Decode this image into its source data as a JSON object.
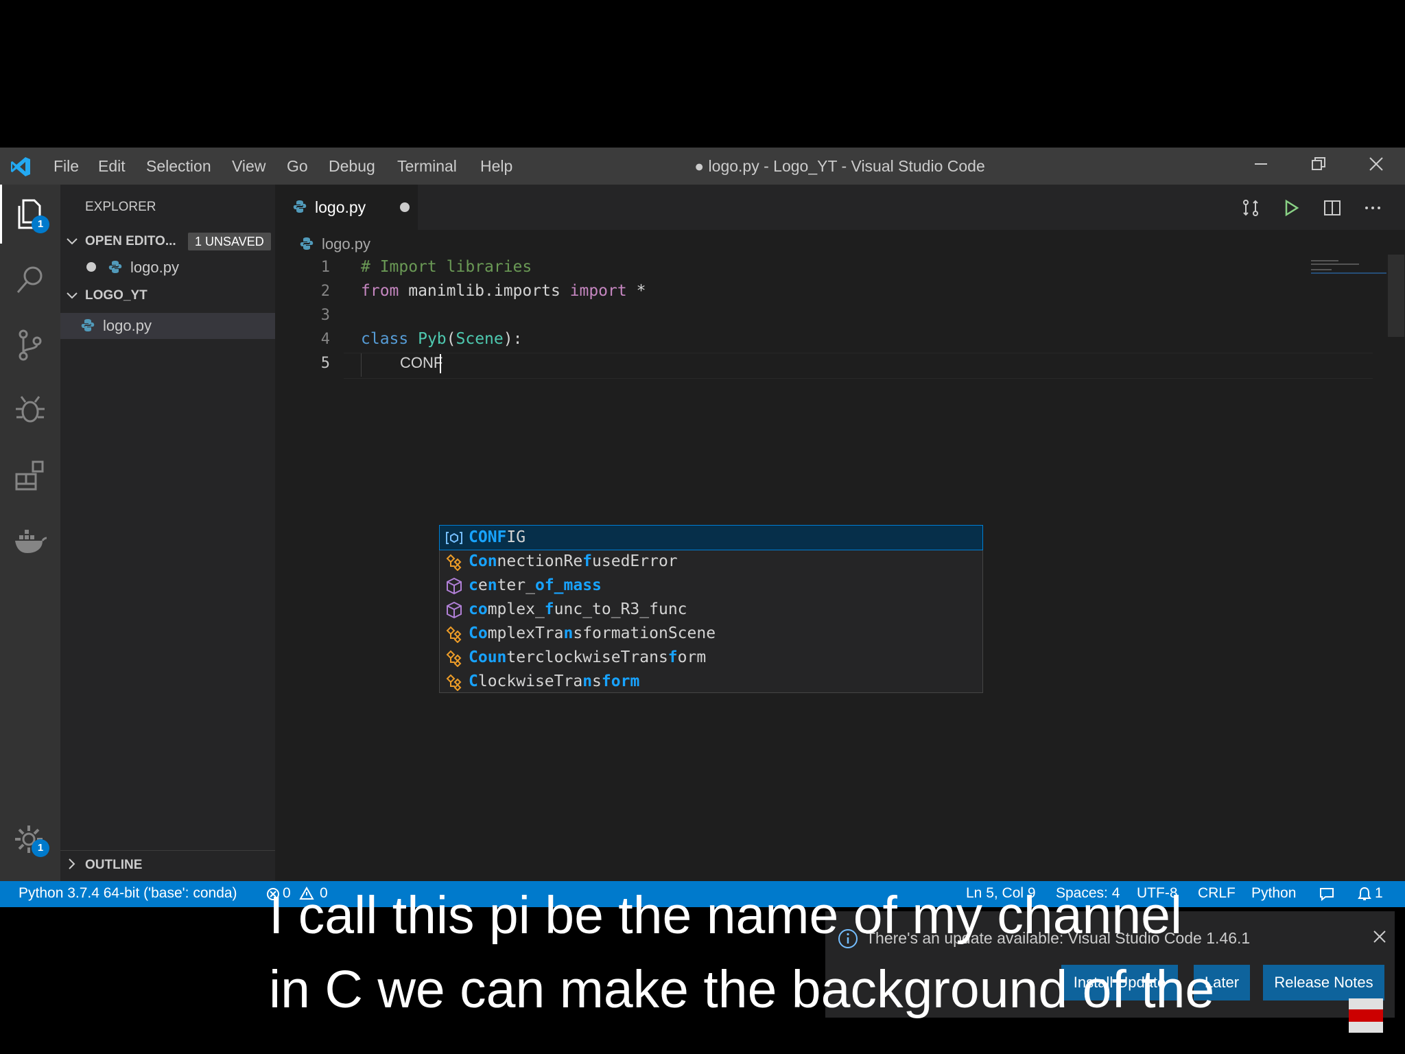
{
  "window": {
    "title": "● logo.py - Logo_YT - Visual Studio Code",
    "menu": [
      "File",
      "Edit",
      "Selection",
      "View",
      "Go",
      "Debug",
      "Terminal",
      "Help"
    ]
  },
  "activity_bar": {
    "explorer_badge": "1",
    "settings_badge": "1"
  },
  "sidebar": {
    "title": "EXPLORER",
    "open_editors_label": "OPEN EDITO...",
    "unsaved_badge": "1 UNSAVED",
    "open_editor_file": "logo.py",
    "folder_label": "LOGO_YT",
    "folder_file": "logo.py",
    "outline_label": "OUTLINE"
  },
  "editor": {
    "tab_label": "logo.py",
    "breadcrumb": "logo.py",
    "line_numbers": [
      "1",
      "2",
      "3",
      "4",
      "5"
    ],
    "line1": "# Import libraries",
    "line2_kw1": "from",
    "line2_mod": " manimlib.imports ",
    "line2_kw2": "import",
    "line2_rest": " *",
    "line4_kw": "class",
    "line4_name": " Pyb",
    "line4_paren1": "(",
    "line4_base": "Scene",
    "line4_paren2": "):",
    "line5": "CONF"
  },
  "suggestions": [
    {
      "pre": "",
      "hl1": "CONF",
      "mid": "IG",
      "hl2": "",
      "post": "",
      "rest": "",
      "icon": "field-icon"
    },
    {
      "pre": "",
      "hl1": "Con",
      "mid": "nectionRe",
      "hl2": "f",
      "post": "usedError",
      "rest": "",
      "icon": "class-icon"
    },
    {
      "pre": "",
      "hl1": "c",
      "mid": "e",
      "hl2": "n",
      "post": "ter_",
      "rest": "of_mass",
      "icon": "module-icon"
    },
    {
      "pre": "",
      "hl1": "co",
      "mid": "mplex_",
      "hl2": "f",
      "post": "unc_to_R3_func",
      "rest": "",
      "icon": "module-icon"
    },
    {
      "pre": "",
      "hl1": "Co",
      "mid": "mplexTra",
      "hl2": "n",
      "post": "sformationScene",
      "rest": "",
      "icon": "class-icon"
    },
    {
      "pre": "",
      "hl1": "Coun",
      "mid": "terclockwiseTrans",
      "hl2": "f",
      "post": "orm",
      "rest": "",
      "icon": "class-icon"
    },
    {
      "pre": "",
      "hl1": "C",
      "mid": "lockwiseTra",
      "hl2": "n",
      "post": "s",
      "rest": "form",
      "icon": "class-icon"
    }
  ],
  "notification": {
    "message": "There's an update available: Visual Studio Code 1.46.1",
    "install": "Install Update",
    "later": "Later",
    "release_notes": "Release Notes"
  },
  "status_bar": {
    "interpreter": "Python 3.7.4 64-bit ('base': conda)",
    "errors": "0",
    "warnings": "0",
    "position": "Ln 5, Col 9",
    "spaces": "Spaces: 4",
    "encoding": "UTF-8",
    "eol": "CRLF",
    "language": "Python",
    "notifications": "1"
  },
  "captions": {
    "line1": "I call this pi be the name of my channel",
    "line2": "in C we can make the background of the"
  },
  "colors": {
    "accent": "#007acc",
    "keyword": "#c586c0",
    "comment": "#6a9955",
    "class_name": "#4ec9b0",
    "storage": "#569cd6",
    "suggest_selected": "#062f4a"
  }
}
